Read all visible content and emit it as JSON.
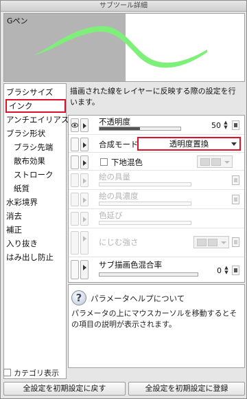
{
  "window": {
    "title": "サブツール詳細"
  },
  "preview": {
    "brush_name": "Gペン",
    "stroke_color": "#7ef07a"
  },
  "categories": {
    "items": [
      {
        "label": "ブラシサイズ",
        "sub": false,
        "selected": false
      },
      {
        "label": "インク",
        "sub": false,
        "selected": true
      },
      {
        "label": "アンチエイリアス",
        "sub": false,
        "selected": false
      },
      {
        "label": "ブラシ形状",
        "sub": false,
        "selected": false
      },
      {
        "label": "ブラシ先端",
        "sub": true,
        "selected": false
      },
      {
        "label": "散布効果",
        "sub": true,
        "selected": false
      },
      {
        "label": "ストローク",
        "sub": true,
        "selected": false
      },
      {
        "label": "紙質",
        "sub": true,
        "selected": false
      },
      {
        "label": "水彩境界",
        "sub": false,
        "selected": false
      },
      {
        "label": "消去",
        "sub": false,
        "selected": false
      },
      {
        "label": "補正",
        "sub": false,
        "selected": false
      },
      {
        "label": "入り抜き",
        "sub": false,
        "selected": false
      },
      {
        "label": "はみ出し防止",
        "sub": false,
        "selected": false
      }
    ],
    "show_categories_label": "カテゴリ表示",
    "show_categories_checked": false
  },
  "description": "描画された線をレイヤーに反映する際の設定を行います。",
  "properties": {
    "opacity": {
      "label": "不透明度",
      "value": "50",
      "fraction": 0.5
    },
    "blend_mode": {
      "label": "合成モード",
      "value": "透明度置換"
    },
    "mix_underlying": {
      "label": "下地混色",
      "checked": false
    },
    "paint_amount": {
      "label": "絵の具量"
    },
    "paint_density": {
      "label": "絵の具濃度"
    },
    "color_stretch": {
      "label": "色延び"
    },
    "blur_strength": {
      "label": "にじむ強さ"
    },
    "sub_color_mix": {
      "label": "サブ描画色混合率",
      "value": "0"
    }
  },
  "help": {
    "title": "パラメータヘルプについて",
    "body": "パラメータの上にマウスカーソルを移動するとその項目の説明が表示されます。"
  },
  "buttons": {
    "reset_all": "全設定を初期設定に戻す",
    "register_all": "全設定を初期設定に登録"
  }
}
